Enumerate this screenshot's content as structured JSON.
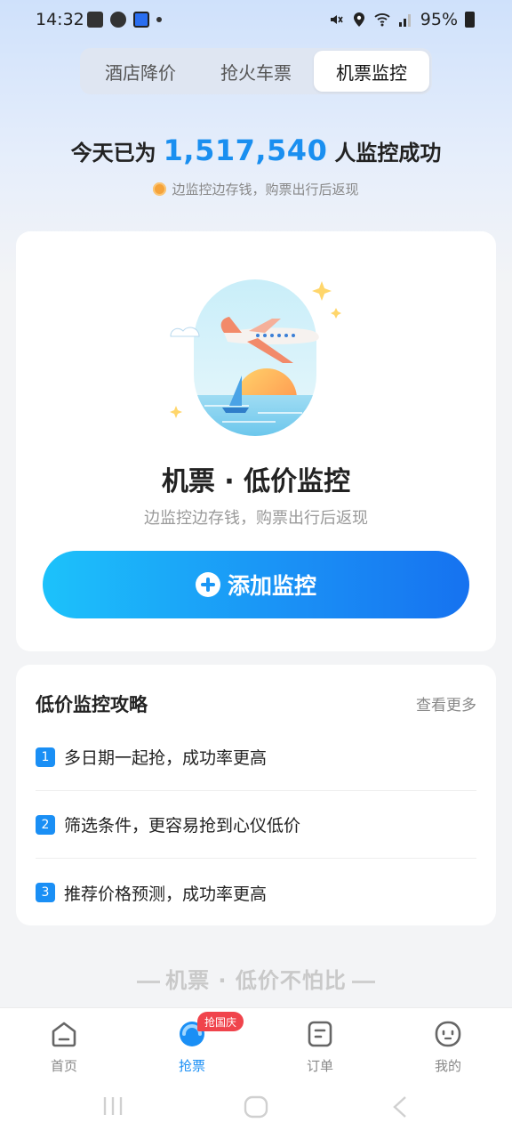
{
  "status_bar": {
    "time": "14:32",
    "battery": "95%"
  },
  "tabs": [
    {
      "label": "酒店降价",
      "active": false
    },
    {
      "label": "抢火车票",
      "active": false
    },
    {
      "label": "机票监控",
      "active": true
    }
  ],
  "headline": {
    "prefix": "今天已为",
    "count": "1,517,540",
    "suffix": "人监控成功",
    "sub": "边监控边存钱，购票出行后返现"
  },
  "main_card": {
    "title": "机票 · 低价监控",
    "subtitle": "边监控边存钱，购票出行后返现",
    "button_label": "添加监控"
  },
  "tips": {
    "title": "低价监控攻略",
    "more": "查看更多",
    "items": [
      {
        "num": "1",
        "text": "多日期一起抢，成功率更高"
      },
      {
        "num": "2",
        "text": "筛选条件，更容易抢到心仪低价"
      },
      {
        "num": "3",
        "text": "推荐价格预测，成功率更高"
      }
    ]
  },
  "banner": {
    "title": "机票 · 低价不怕比"
  },
  "bottom_nav": {
    "badge": "抢国庆",
    "items": [
      {
        "label": "首页",
        "icon": "home-icon"
      },
      {
        "label": "抢票",
        "icon": "grab-ticket-icon"
      },
      {
        "label": "订单",
        "icon": "order-icon"
      },
      {
        "label": "我的",
        "icon": "profile-icon"
      }
    ]
  },
  "colors": {
    "accent": "#1a8ff5",
    "badge": "#f0444c"
  }
}
